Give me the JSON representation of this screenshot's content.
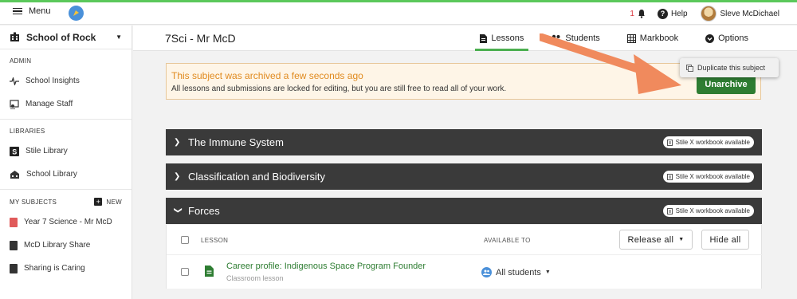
{
  "topbar": {
    "menu_label": "Menu",
    "notification_count": "1",
    "help_label": "Help",
    "user_name": "Sleve McDichael"
  },
  "sidebar": {
    "school_name": "School of Rock",
    "admin_heading": "ADMIN",
    "admin_items": [
      {
        "label": "School Insights",
        "icon": "pulse-icon"
      },
      {
        "label": "Manage Staff",
        "icon": "staff-icon"
      }
    ],
    "libraries_heading": "LIBRARIES",
    "library_items": [
      {
        "label": "Stile Library",
        "icon": "stile-s-icon"
      },
      {
        "label": "School Library",
        "icon": "school-building-icon"
      }
    ],
    "subjects_heading": "MY SUBJECTS",
    "new_label": "NEW",
    "subject_items": [
      {
        "label": "Year 7 Science - Mr McD",
        "color": "#e05a5a"
      },
      {
        "label": "McD Library Share",
        "color": "#333333"
      },
      {
        "label": "Sharing is Caring",
        "color": "#333333"
      }
    ]
  },
  "subheader": {
    "title": "7Sci - Mr McD",
    "tabs": [
      {
        "label": "Lessons",
        "icon": "document-icon",
        "active": true
      },
      {
        "label": "Students",
        "icon": "people-icon",
        "active": false
      },
      {
        "label": "Markbook",
        "icon": "grid-icon",
        "active": false
      },
      {
        "label": "Options",
        "icon": "chevron-circle-icon",
        "active": false
      }
    ]
  },
  "banner": {
    "title": "This subject was archived a few seconds ago",
    "text": "All lessons and submissions are locked for editing, but you are still free to read all of your work.",
    "button_label": "Unarchive"
  },
  "options_dropdown": {
    "item_label": "Duplicate this subject"
  },
  "sections": [
    {
      "title": "The Immune System",
      "expanded": false,
      "badge": "Stile X workbook available"
    },
    {
      "title": "Classification and Biodiversity",
      "expanded": false,
      "badge": "Stile X workbook available"
    },
    {
      "title": "Forces",
      "expanded": true,
      "badge": "Stile X workbook available"
    }
  ],
  "lesson_table": {
    "col_lesson": "LESSON",
    "col_available": "AVAILABLE TO",
    "release_all_label": "Release all",
    "hide_all_label": "Hide all",
    "rows": [
      {
        "title": "Career profile: Indigenous Space Program Founder",
        "type": "Classroom lesson",
        "available_to": "All students"
      }
    ]
  },
  "colors": {
    "accent_green": "#4caf50",
    "archive_orange": "#e08a1e",
    "arrow_orange": "#f08a5d",
    "section_dark": "#3a3a3a"
  }
}
